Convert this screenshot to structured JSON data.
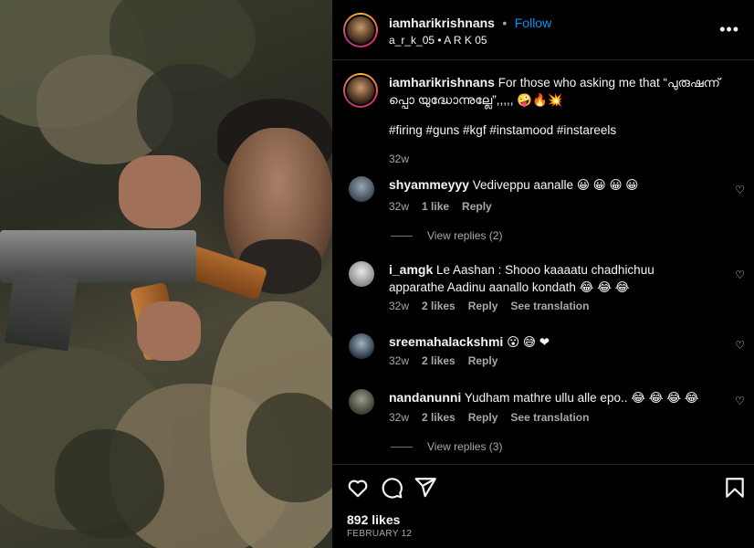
{
  "post": {
    "author": "iamharikrishnans",
    "follow_label": "Follow",
    "separator": "•",
    "audio": "a_r_k_05 • A R K 05",
    "more_label": "•••",
    "caption_text": "For those who asking me that “പുരുഷന്ന് പ്പൊ യുദ്ധോന്നുല്ലേ”,,,,, 🤪🔥💥",
    "hashtags": "#firing #guns #kgf #instamood #instareels",
    "caption_time": "32w"
  },
  "comments": [
    {
      "user": "shyammeyyy",
      "text": "Vediveppu aanalle 😀 😀 😀 😀",
      "time": "32w",
      "likes": "1 like",
      "reply": "Reply",
      "translation": "",
      "view_replies": "View replies (2)"
    },
    {
      "user": "i_amgk",
      "text": "Le Aashan : Shooo kaaaatu chadhichuu apparathe Aadinu aanallo kondath 😂 😂 😂",
      "time": "32w",
      "likes": "2 likes",
      "reply": "Reply",
      "translation": "See translation",
      "view_replies": ""
    },
    {
      "user": "sreemahalackshmi",
      "text": "😮 😅 ❤",
      "time": "32w",
      "likes": "2 likes",
      "reply": "Reply",
      "translation": "",
      "view_replies": ""
    },
    {
      "user": "nandanunni",
      "text": "Yudham mathre ullu alle epo.. 😂 😂 😂 😂",
      "time": "32w",
      "likes": "2 likes",
      "reply": "Reply",
      "translation": "See translation",
      "view_replies": "View replies (3)"
    }
  ],
  "footer": {
    "likes": "892 likes",
    "date": "FEBRUARY 12"
  },
  "icons": {
    "like": "heart-icon",
    "comment": "comment-icon",
    "share": "share-icon",
    "save": "bookmark-icon",
    "more": "more-icon"
  },
  "colors": {
    "background": "#000000",
    "link": "#0095f6",
    "muted": "#a8a8a8",
    "heart_red": "#ed4956"
  }
}
